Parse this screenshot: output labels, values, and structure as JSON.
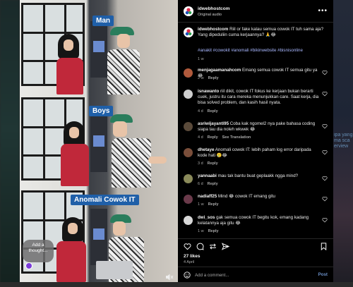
{
  "post": {
    "username": "idwebhostcom",
    "audio": "Original audio"
  },
  "video": {
    "captions": [
      "Man",
      "Boys",
      "Anomali Cowok IT"
    ],
    "thought_bubble": "Add a thought...",
    "mute_icon": "speaker-muted-icon"
  },
  "caption": {
    "username": "idwebhostcom",
    "text": "Riil or fake kalau semua cowok IT tuh sama aja? Yang dipeduliin cuma kerjaannya? 🙏😂",
    "hashtags": "#anakit #cowokit #anomali #bikinwebsite #bisnisonline",
    "time": "1 w"
  },
  "comments": [
    {
      "user": "menjagaamanahcom",
      "text": "Emang semua cowok IT semua gitu ya 😂",
      "time": "2 w",
      "reply": "Reply",
      "avatar_color": "#b05a3c"
    },
    {
      "user": "isnawanto",
      "text": "riil dikit, cowok IT fokus ke kerjaan bukan berarti cuek, justru itu cara mereka menunjukkan care. Saat kerja, dia bisa solved problem, dan kasih hasil nyata.",
      "time": "4 d",
      "reply": "Reply",
      "avatar_color": "#cfcfcf"
    },
    {
      "user": "asriwijayanti95",
      "text": "Coba kak ngomel2 nya pake bahasa coding siapa tau dia noleh wkwek 😂",
      "time": "4 d",
      "reply": "Reply",
      "extra": "See Translation",
      "avatar_color": "#5a4a3a"
    },
    {
      "user": "dhetaye",
      "text": "Anomali cowok IT: lebih paham log error daripada kode hati 🥲😂",
      "time": "3 d",
      "reply": "Reply",
      "avatar_color": "#7a4e3a"
    },
    {
      "user": "yannaabi",
      "text": "mau tak bantu buat geplaakk ngga mind?",
      "time": "6 d",
      "reply": "Reply",
      "avatar_color": "#8a8a5a"
    },
    {
      "user": "nadiaff25",
      "text": "Mind 😂 cowok IT emang gitu",
      "time": "1 w",
      "reply": "Reply",
      "avatar_color": "#6a3a4a"
    },
    {
      "user": "dwi_sos",
      "text": "gak semua cowok IT begitu kok, emang kadang kelatannya aja gitu 😂",
      "time": "1 w",
      "reply": "Reply",
      "avatar_color": "#d8d8d8"
    }
  ],
  "stats": {
    "likes": "27 likes",
    "date": "4 April"
  },
  "composer": {
    "placeholder": "Add a comment...",
    "post_label": "Post"
  },
  "background": {
    "right_text": "ipa yang ma sca erview"
  }
}
